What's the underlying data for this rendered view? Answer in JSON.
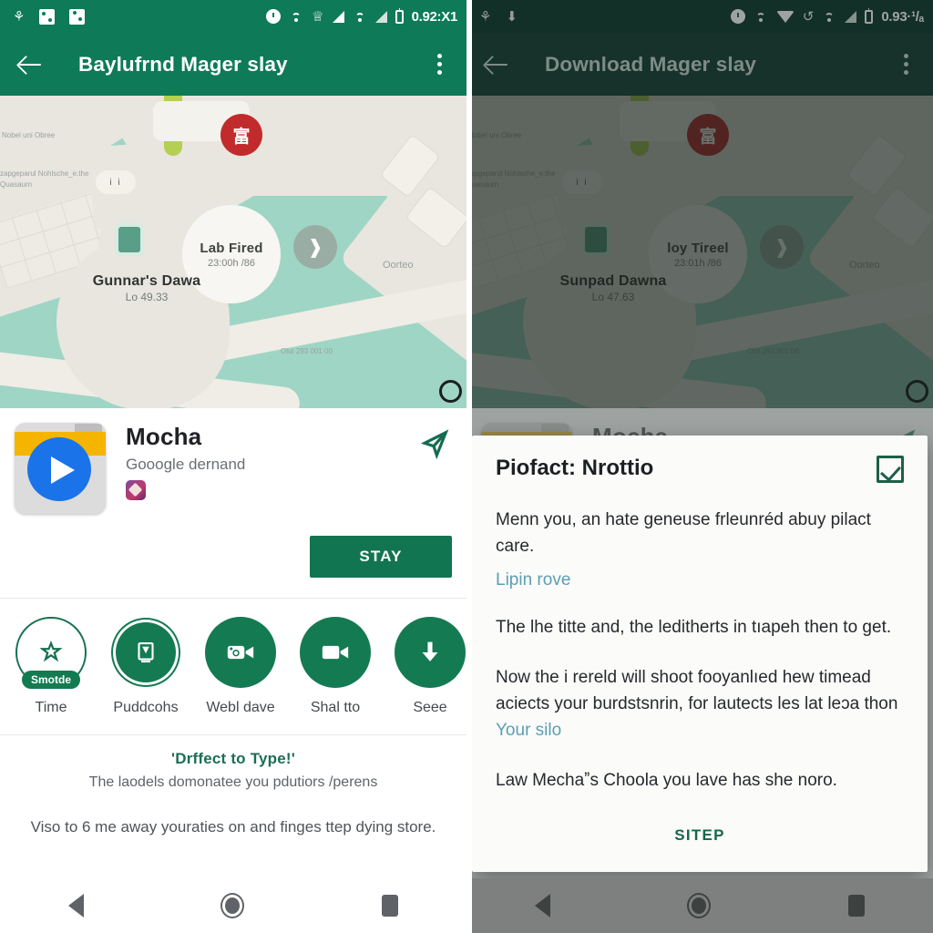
{
  "left": {
    "statusbar": {
      "icons_left": [
        "settings-sync-icon",
        "alarm-box-icon",
        "dice-box-icon"
      ],
      "icons_right": [
        "alarm-icon",
        "wifi-icon",
        "vpn-crown-icon",
        "signal-icon",
        "wifi-2-icon",
        "signal-2-icon",
        "battery-icon"
      ],
      "battery_text": "0.92:X1"
    },
    "appbar": {
      "title": "Baylufrnd Mager slay",
      "back": "back-arrow",
      "overflow": "more-options"
    },
    "map": {
      "big_label": "Lab Fired",
      "big_sub": "23:00h /86",
      "town_label": "Gunnar's Dawa",
      "town_sub": "Lo 49.33",
      "red_badge": "富",
      "small_pill": "i i",
      "gray_circle": "❱",
      "blue_marker": "i",
      "fab": "+",
      "micro_1": "Nobel uni Obree",
      "micro_2": "zapgeparul Nohlsche_e.the Quasaurn",
      "micro_3": "Oorteo",
      "micro_4": "Olut 293 001 00"
    },
    "app": {
      "name": "Mocha",
      "developer": "Gooogle dernand",
      "share_icon": "share-send-icon",
      "cta_label": "STAY"
    },
    "features": [
      {
        "label": "Time",
        "icon": "star-dome-icon",
        "badge": "Smotde",
        "style": "outline"
      },
      {
        "label": "Puddcohs",
        "icon": "certificate-badge-icon",
        "badge": "",
        "style": "spiky"
      },
      {
        "label": "Webl dave",
        "icon": "video-camera-icon",
        "badge": "",
        "style": "solid"
      },
      {
        "label": "Shal tto",
        "icon": "chat-video-icon",
        "badge": "",
        "style": "solid"
      },
      {
        "label": "Seee",
        "icon": "download-icon",
        "badge": "",
        "style": "solid"
      }
    ],
    "blurb": {
      "headline": "'Drffect to Type!'",
      "line1": "The laodels domonatee you pdutiors /perens",
      "line2": "Viso to 6 me away youraties on and finges ttep dying store."
    },
    "navbar": {
      "back": "nav-back-icon",
      "home": "nav-home-icon",
      "recents": "nav-recents-icon"
    }
  },
  "right": {
    "statusbar": {
      "icons_left": [
        "settings-sync-icon",
        "download-box-icon"
      ],
      "icons_right": [
        "alarm-icon",
        "wifi-icon",
        "wifi-filled-icon",
        "rotate-icon",
        "wifi-2-icon",
        "signal-icon",
        "battery-icon"
      ],
      "battery_text": "0.93·¹/ₐ"
    },
    "appbar": {
      "title": "Download Mager slay",
      "back": "back-arrow",
      "overflow": "more-options"
    },
    "map": {
      "big_label": "loy Tireel",
      "big_sub": "23:01h /86",
      "town_label": "Sunpad Dawna",
      "town_sub": "Lo 47.63",
      "red_badge": "富",
      "small_pill": "i i",
      "gray_circle": "❱",
      "blue_marker": "≡",
      "fab": "+",
      "micro_1": "Nobel uni Obree",
      "micro_2": "zapgeparul Nohlsche_e.the Quasaurn",
      "micro_3": "Oorteo",
      "micro_4": "Olut 293 001 00"
    },
    "dialog": {
      "title": "Piofact: Nrottio",
      "checkbox": "checked-checkbox-icon",
      "paragraph_1": "Menn you, an hate geneuse frleunréd abuy pilact care.",
      "link_1": "Lipin rove",
      "paragraph_2": "The lhe titte and, the leditherts in tıapeh then to get.",
      "paragraph_3_pre": "Now the i rereld will shoot fooyanlıed hew timead aciects your burdstsnrin, for lautects les lat leɔa thon ",
      "paragraph_3_link": "Your silo",
      "paragraph_4": "Law Mechaˮs Choola you lave has she noro.",
      "action_label": "SITEP"
    },
    "navbar": {
      "back": "nav-back-icon",
      "home": "nav-home-icon",
      "recents": "nav-recents-icon"
    }
  }
}
